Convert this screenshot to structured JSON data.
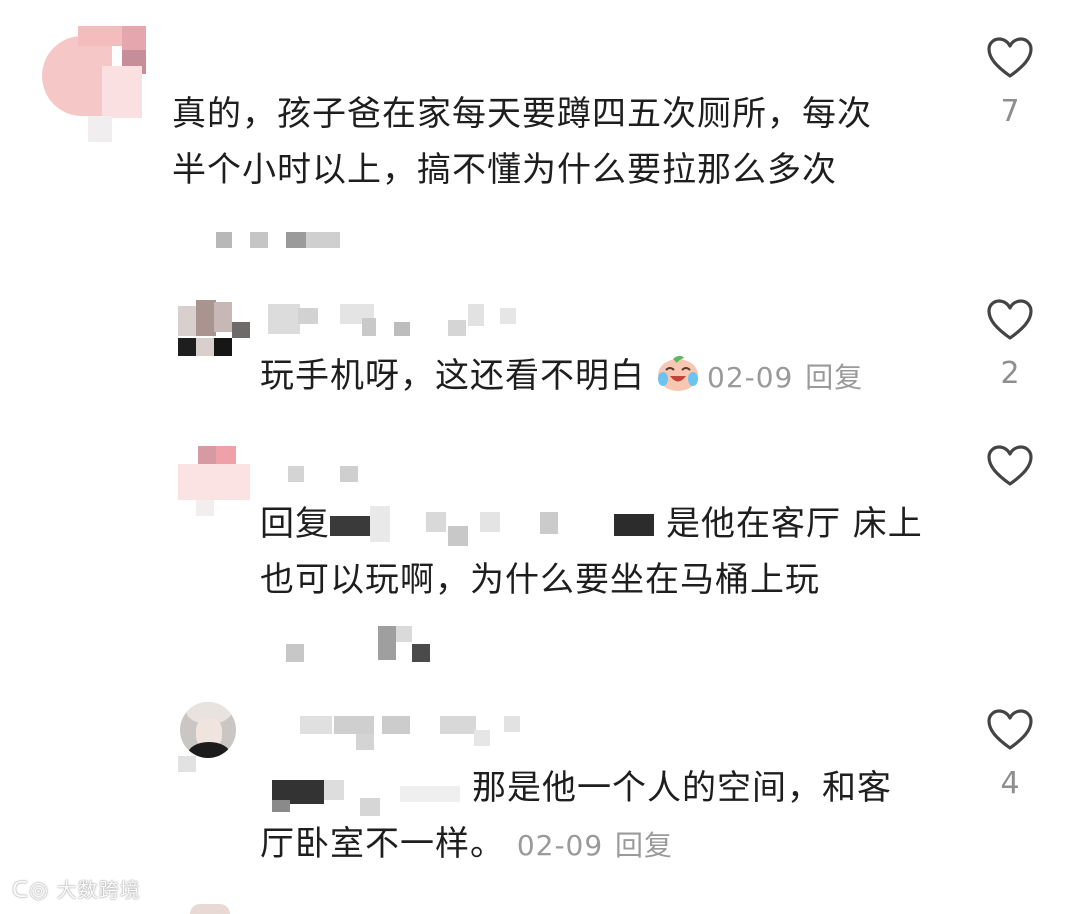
{
  "comments": [
    {
      "text_lines": [
        "真的，孩子爸在家每天要蹲四五次厕所，每次",
        "半个小时以上，搞不懂为什么要拉那么多次"
      ],
      "likes": "7"
    },
    {
      "text": "玩手机呀，这还看不明白",
      "date": "02-09",
      "reply_label": "回复",
      "likes": "2"
    },
    {
      "text_prefix": "回复",
      "text_tail": "是他在客厅 床上",
      "text_line2": "也可以玩啊，为什么要坐在马桶上玩"
    },
    {
      "text_head": "那是他一个人的空间，和客",
      "text_line2": "厅卧室不一样。",
      "date": "02-09",
      "reply_label": "回复",
      "likes": "4"
    }
  ],
  "watermark": "大数跨境",
  "colors": {
    "meta": "#9a9a9a",
    "text": "#1e1e1e",
    "heart": "#444444"
  },
  "icons": [
    "heart-icon",
    "crying-laughing-emoji"
  ]
}
